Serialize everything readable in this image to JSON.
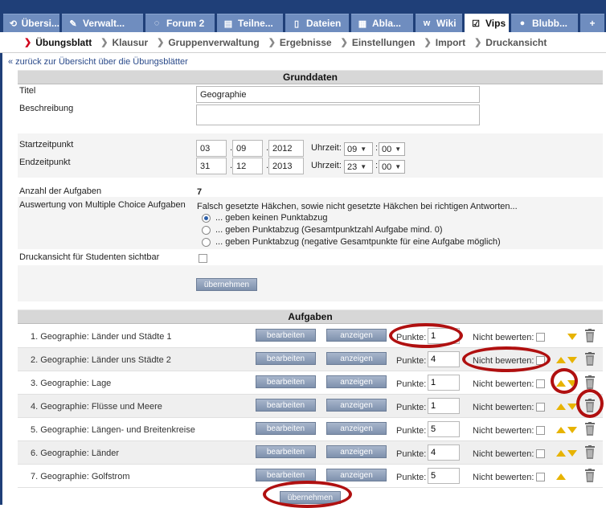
{
  "tabs": [
    {
      "label": "Übersi...",
      "icon": "overview-icon"
    },
    {
      "label": "Verwalt...",
      "icon": "wrench-icon"
    },
    {
      "label": "Forum 2",
      "icon": "forum-icon"
    },
    {
      "label": "Teilne...",
      "icon": "participants-icon"
    },
    {
      "label": "Dateien",
      "icon": "files-icon"
    },
    {
      "label": "Abla...",
      "icon": "schedule-icon"
    },
    {
      "label": "Wiki",
      "icon": "wiki-icon"
    },
    {
      "label": "Vips",
      "icon": "vips-check-icon"
    },
    {
      "label": "Blubb...",
      "icon": "blubber-icon"
    },
    {
      "label": "+",
      "icon": "plus-icon"
    }
  ],
  "subnav": [
    "Übungsblatt",
    "Klausur",
    "Gruppenverwaltung",
    "Ergebnisse",
    "Einstellungen",
    "Import",
    "Druckansicht"
  ],
  "back_link": "« zurück zur Übersicht über die Übungsblätter",
  "grunddaten": {
    "header": "Grunddaten",
    "titel_label": "Titel",
    "titel_value": "Geographie",
    "beschreibung_label": "Beschreibung",
    "beschreibung_value": "",
    "start_label": "Startzeitpunkt",
    "start_day": "03",
    "start_month": "09",
    "start_year": "2012",
    "start_hour": "09",
    "start_min": "00",
    "end_label": "Endzeitpunkt",
    "end_day": "31",
    "end_month": "12",
    "end_year": "2013",
    "end_hour": "23",
    "end_min": "00",
    "uhrzeit_label": "Uhrzeit:",
    "dot": ".",
    "colon": ":",
    "anzahl_label": "Anzahl der Aufgaben",
    "anzahl_value": "7",
    "auswertung_label": "Auswertung von Multiple Choice Aufgaben",
    "auswertung_text": "Falsch gesetzte Häkchen, sowie nicht gesetzte Häkchen bei richtigen Antworten...",
    "options": [
      "... geben keinen Punktabzug",
      "... geben Punktabzug (Gesamtpunktzahl Aufgabe mind. 0)",
      "... geben Punktabzug (negative Gesamtpunkte für eine Aufgabe möglich)"
    ],
    "selected_option": 0,
    "druck_label": "Druckansicht für Studenten sichtbar",
    "submit_label": "übernehmen"
  },
  "aufgaben": {
    "header": "Aufgaben",
    "edit_label": "bearbeiten",
    "show_label": "anzeigen",
    "punkte_label": "Punkte:",
    "nicht_bewerten_label": "Nicht bewerten:",
    "submit_label": "übernehmen",
    "rows": [
      {
        "title": "1. Geographie: Länder und Städte 1",
        "punkte": "1"
      },
      {
        "title": "2. Geographie: Länder uns Städte 2",
        "punkte": "4"
      },
      {
        "title": "3. Geographie: Lage",
        "punkte": "1"
      },
      {
        "title": "4. Geographie: Flüsse und Meere",
        "punkte": "1"
      },
      {
        "title": "5. Geographie: Längen- und Breitenkreise",
        "punkte": "5"
      },
      {
        "title": "6. Geographie: Länder",
        "punkte": "4"
      },
      {
        "title": "7. Geographie: Golfstrom",
        "punkte": "5"
      }
    ]
  },
  "colors": {
    "navbar": "#1f3f78",
    "tab": "#6f8dbf",
    "annotation": "#b01010",
    "arrow": "#e7b300"
  }
}
